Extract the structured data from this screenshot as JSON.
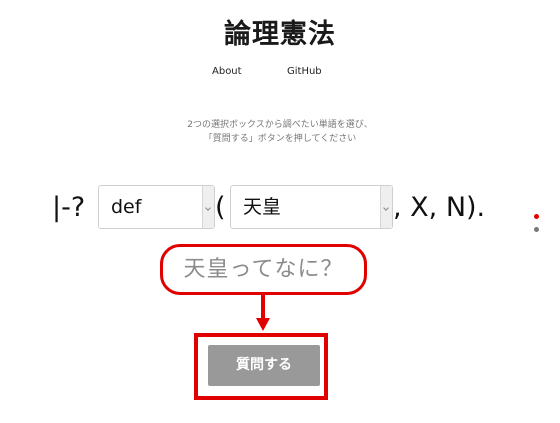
{
  "header": {
    "title": "論理憲法"
  },
  "nav": {
    "about": "About",
    "github": "GitHub"
  },
  "instructions": {
    "line1": "2つの選択ボックスから調べたい単語を選び、",
    "line2": "「質問する」ボタンを押してください"
  },
  "query": {
    "prefix": "|-?",
    "open_paren": "(",
    "suffix": ", X, N).",
    "predicate_select": {
      "value": "def"
    },
    "term_select": {
      "value": "天皇"
    }
  },
  "callout": {
    "text": "天皇ってなに？"
  },
  "actions": {
    "ask_label": "質問する"
  },
  "colors": {
    "annotation_red": "#e00000",
    "button_gray": "#999999",
    "callout_text": "#8c8c8c"
  }
}
